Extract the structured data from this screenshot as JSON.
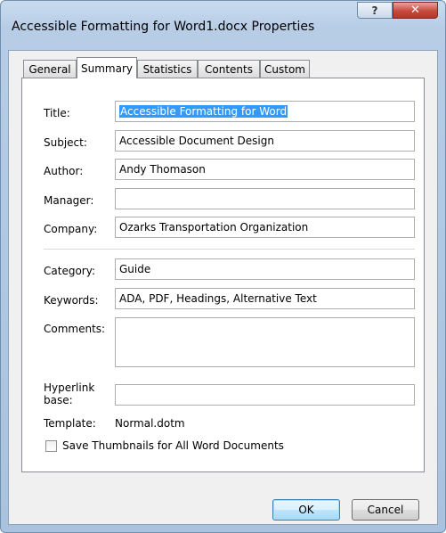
{
  "window": {
    "title": "Accessible Formatting for Word1.docx Properties",
    "help_label": "?",
    "close_label": "✕"
  },
  "tabs": [
    {
      "label": "General"
    },
    {
      "label": "Summary"
    },
    {
      "label": "Statistics"
    },
    {
      "label": "Contents"
    },
    {
      "label": "Custom"
    }
  ],
  "active_tab": "Summary",
  "fields": {
    "title": {
      "label": "Title:",
      "value": "Accessible Formatting for Word"
    },
    "subject": {
      "label": "Subject:",
      "value": "Accessible Document Design"
    },
    "author": {
      "label": "Author:",
      "value": "Andy Thomason"
    },
    "manager": {
      "label": "Manager:",
      "value": ""
    },
    "company": {
      "label": "Company:",
      "value": "Ozarks Transportation Organization"
    },
    "category": {
      "label": "Category:",
      "value": "Guide"
    },
    "keywords": {
      "label": "Keywords:",
      "value": "ADA, PDF, Headings, Alternative Text"
    },
    "comments": {
      "label": "Comments:",
      "value": ""
    },
    "hyperlink_base": {
      "label_line1": "Hyperlink",
      "label_line2": "base:",
      "value": ""
    },
    "template": {
      "label": "Template:",
      "value": "Normal.dotm"
    }
  },
  "save_thumbnails": {
    "label": "Save Thumbnails for All Word Documents",
    "checked": false
  },
  "buttons": {
    "ok": "OK",
    "cancel": "Cancel"
  },
  "colors": {
    "selection": "#3399ff",
    "close_button": "#c74a3d",
    "title_bar": "#b7cde6"
  }
}
